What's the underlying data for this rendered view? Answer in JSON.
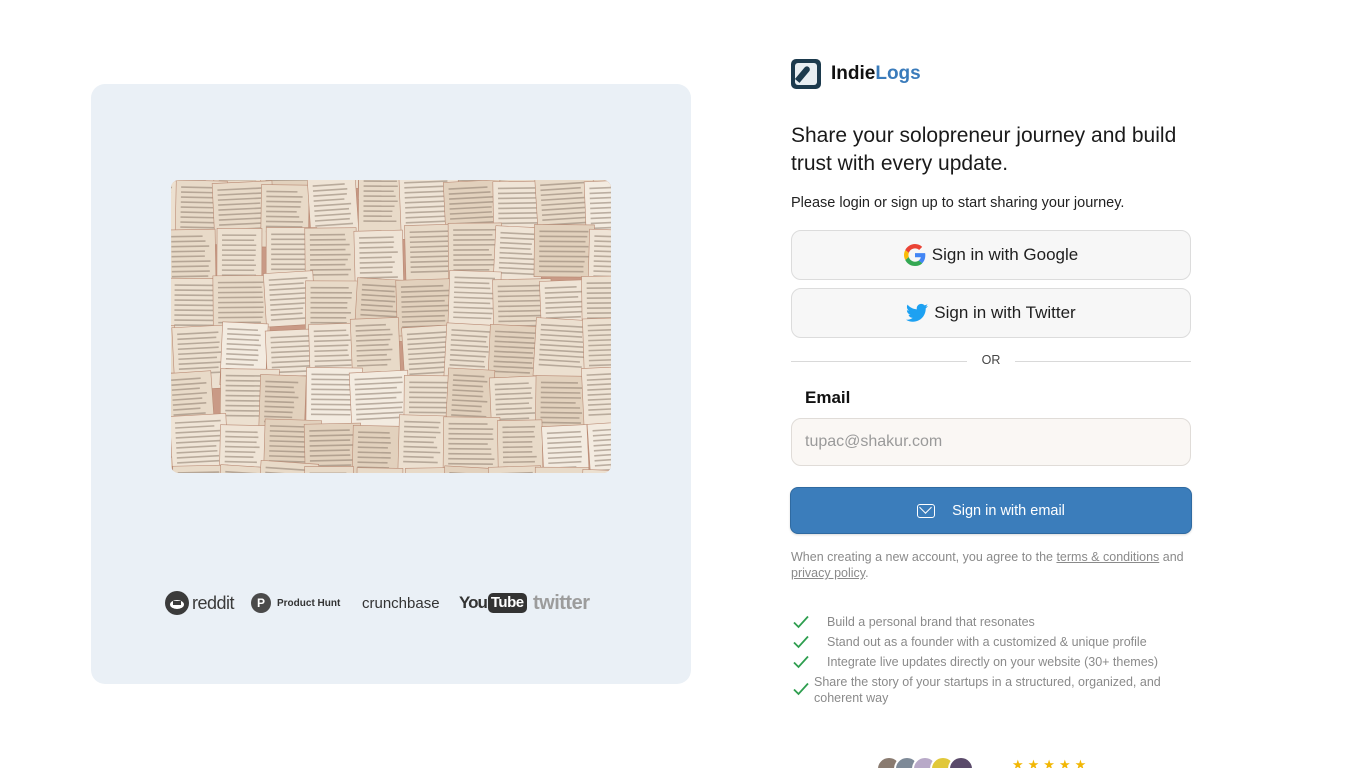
{
  "brand": {
    "name_part1": "Indie",
    "name_part2": "Logs",
    "logo_icon": "quill-icon",
    "accent_color": "#3a7bbb"
  },
  "hero": {
    "image": "open-books-photo"
  },
  "press_logos": [
    {
      "name": "reddit",
      "label": "reddit"
    },
    {
      "name": "product-hunt",
      "letter": "P",
      "label": "Product Hunt"
    },
    {
      "name": "crunchbase",
      "label": "crunchbase"
    },
    {
      "name": "youtube",
      "label_you": "You",
      "label_tube": "Tube"
    },
    {
      "name": "twitter",
      "label": "twitter"
    }
  ],
  "auth": {
    "headline": "Share your solopreneur journey and build trust with every update.",
    "subline": "Please login or sign up to start sharing your journey.",
    "google_label": "Sign in with Google",
    "twitter_label": "Sign in with Twitter",
    "divider": "OR",
    "email_label": "Email",
    "email_placeholder": "tupac@shakur.com",
    "email_value": "",
    "email_button": "Sign in with email",
    "primary_color": "#3b7dbb"
  },
  "terms": {
    "prefix": "When creating a new account, you agree to the ",
    "terms_link": "terms & conditions",
    "middle": " and ",
    "privacy_link": "privacy policy",
    "suffix": "."
  },
  "features": [
    "Build a personal brand that resonates",
    "Stand out as a founder with a customized & unique profile",
    "Integrate live updates directly on your website (30+ themes)",
    "Share the story of your startups in a structured, organized, and coherent way"
  ],
  "social_proof": {
    "avatar_count": 5,
    "star_rating": 5,
    "star_color": "#f2b705"
  }
}
